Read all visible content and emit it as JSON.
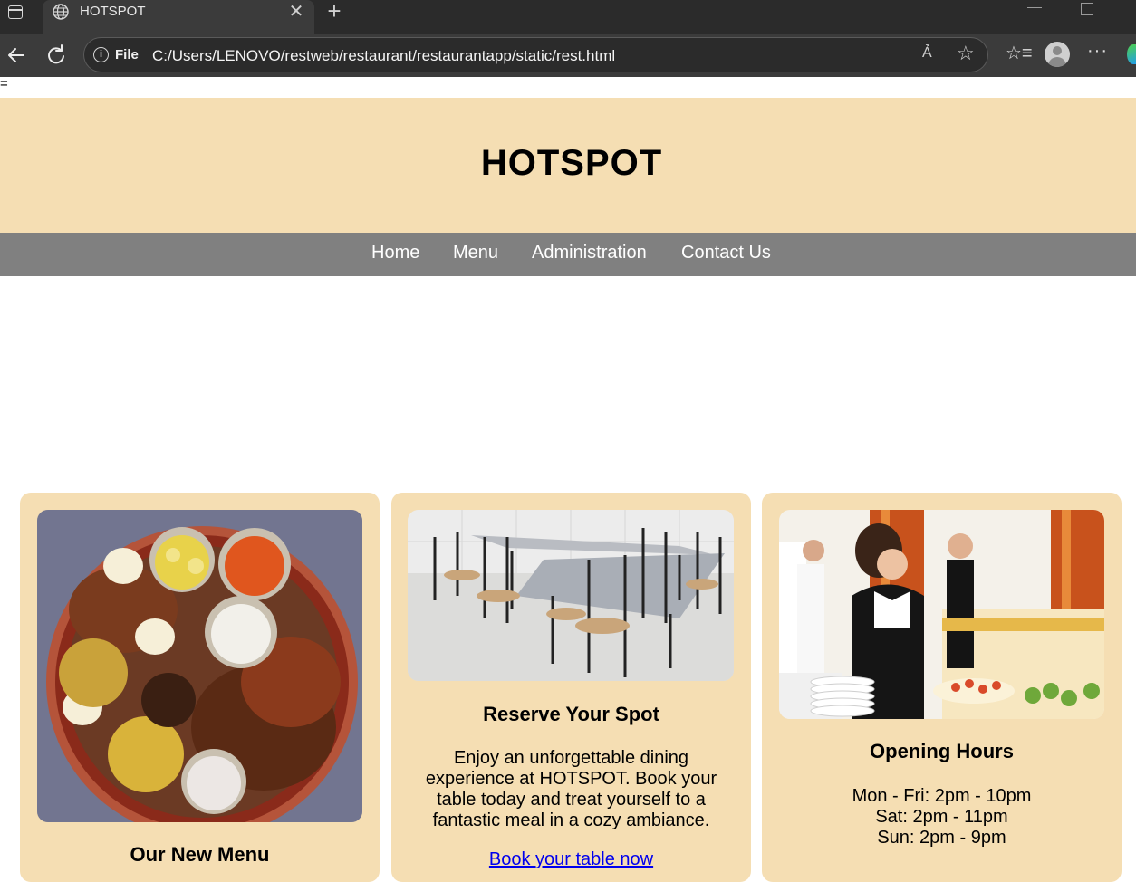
{
  "browser": {
    "tab_title": "HOTSPOT",
    "file_label": "File",
    "url": "C:/Users/LENOVO/restweb/restaurant/restaurantapp/static/rest.html",
    "read_aloud_label": "Ả"
  },
  "page": {
    "stray_text": "=",
    "site_title": "HOTSPOT",
    "nav": [
      {
        "label": "Home"
      },
      {
        "label": "Menu"
      },
      {
        "label": "Administration"
      },
      {
        "label": "Contact Us"
      }
    ],
    "cards": [
      {
        "heading": "Our New Menu",
        "image": "food-platter-image"
      },
      {
        "heading": "Reserve Your Spot",
        "image": "dining-tables-image",
        "text_lines": [
          "Enjoy an unforgettable dining",
          "experience at HOTSPOT. Book your",
          "table today and treat yourself to a",
          "fantastic meal in a cozy ambiance."
        ],
        "link": "Book your table now"
      },
      {
        "heading": "Opening Hours",
        "image": "waitress-buffet-image",
        "text_lines": [
          "Mon - Fri: 2pm - 10pm",
          "Sat: 2pm - 11pm",
          "Sun: 2pm - 9pm"
        ]
      }
    ]
  },
  "colors": {
    "header_bg": "#f5deb3",
    "nav_bg": "#808080",
    "card_bg": "#f5deb3",
    "link": "#0000ee"
  }
}
